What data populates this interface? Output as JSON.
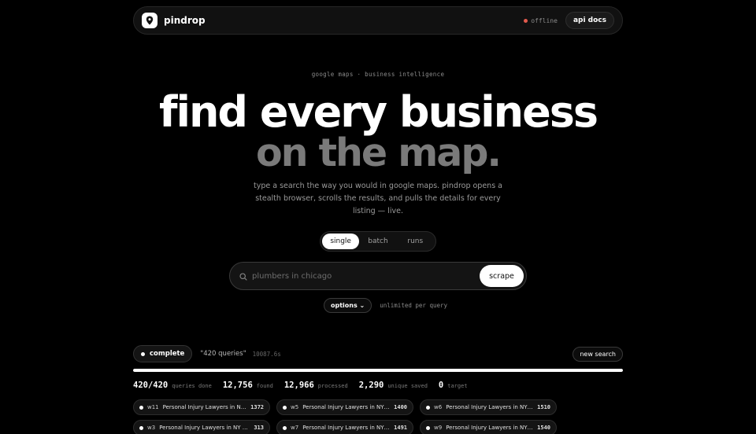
{
  "header": {
    "brand": "pindrop",
    "status_text": "offline",
    "status_color": "#e35a4d",
    "api_docs_label": "api docs"
  },
  "hero": {
    "eyebrow": "google maps · business intelligence",
    "headline_line1": "find every business",
    "headline_line2": "on the map.",
    "lede": "type a search the way you would in google maps. pindrop opens a stealth browser, scrolls the results, and pulls the details for every listing — live."
  },
  "tabs": [
    {
      "label": "single",
      "active": true
    },
    {
      "label": "batch",
      "active": false
    },
    {
      "label": "runs",
      "active": false
    }
  ],
  "search": {
    "placeholder": "plumbers in chicago",
    "value": "",
    "button_label": "scrape"
  },
  "options": {
    "label": "options ⌄",
    "hint": "unlimited per query"
  },
  "run": {
    "status": "complete",
    "query": "\"420 queries\"",
    "elapsed": "10087.6s",
    "new_search_label": "new search",
    "progress": 1.0
  },
  "stats": [
    {
      "value": "420/420",
      "label": "queries done"
    },
    {
      "value": "12,756",
      "label": "found"
    },
    {
      "value": "12,966",
      "label": "processed"
    },
    {
      "value": "2,290",
      "label": "unique saved"
    },
    {
      "value": "0",
      "label": "target"
    }
  ],
  "workers": [
    {
      "id": "w11",
      "query": "Personal Injury Lawyers in NY 14…",
      "count": "1372"
    },
    {
      "id": "w5",
      "query": "Personal Injury Lawyers in NY 14…",
      "count": "1400"
    },
    {
      "id": "w6",
      "query": "Personal Injury Lawyers in NY 13…",
      "count": "1510"
    },
    {
      "id": "w3",
      "query": "Personal Injury Lawyers in NY 12419",
      "count": "313"
    },
    {
      "id": "w7",
      "query": "Personal Injury Lawyers in NY 14…",
      "count": "1491"
    },
    {
      "id": "w9",
      "query": "Personal Injury Lawyers in NY 13…",
      "count": "1540"
    }
  ]
}
